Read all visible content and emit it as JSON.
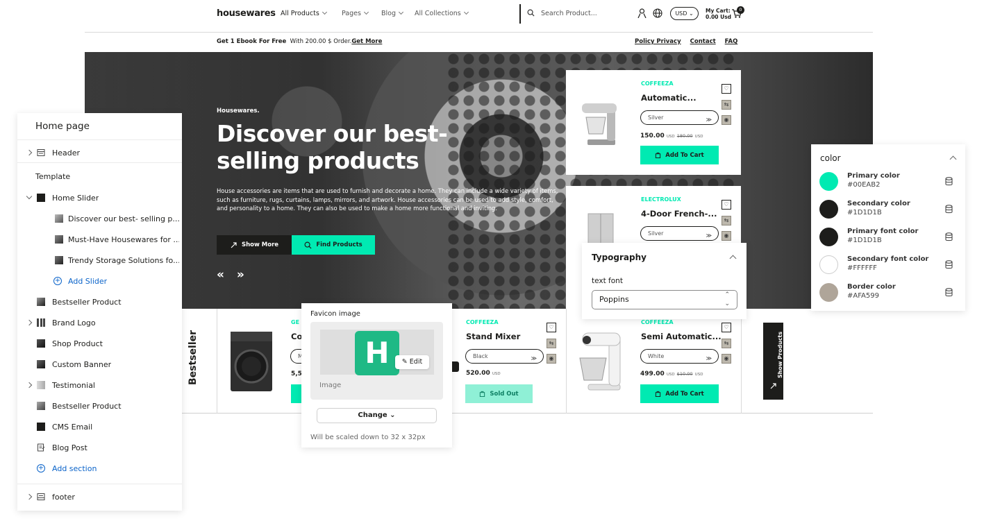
{
  "nav": {
    "logo": "housewares",
    "menu": [
      "All Products",
      "Pages",
      "Blog",
      "All Collections"
    ],
    "search_placeholder": "Search Product...",
    "currency": "USD",
    "cart_label": "My Cart:",
    "cart_total": "0.00 Usd",
    "cart_count": "0"
  },
  "promo": {
    "bold": "Get 1 Ebook For Free",
    "text": "With 200.00 $ Order.",
    "link": "Get More",
    "links": [
      "Policy Privacy",
      "Contact",
      "FAQ"
    ]
  },
  "hero": {
    "eyebrow": "Housewares.",
    "title": "Discover our best- selling products",
    "description": "House accessories are items that are used to furnish and decorate a home. They can include a wide variety of items, such as furniture, rugs, curtains, lamps, mirrors, and artwork. House accessories can be used to add style, comfort, and personality to a home. They can also be used to make a home more functional and inviting.",
    "btn_more": "Show More",
    "btn_find": "Find Products",
    "arrows": "« »"
  },
  "products": [
    {
      "brand": "COFFEEZA",
      "name": "Automatic...",
      "variant": "Silver",
      "price": "150.00",
      "currency": "USD",
      "old_price": "180.00",
      "old_currency": "USD",
      "cta": "Add To Cart"
    },
    {
      "brand": "ELECTROLUX",
      "name": "4-Door French-...",
      "variant": "Silver"
    },
    {
      "brand": "GE",
      "name": "Co",
      "variant": "M",
      "price": "5,5"
    },
    {
      "brand": "COFFEEZA",
      "name": "Stand Mixer",
      "variant": "Black",
      "price": "520.00",
      "currency": "USD",
      "cta": "Sold Out"
    },
    {
      "brand": "COFFEEZA",
      "name": "Semi Automatic...",
      "variant": "White",
      "price": "499.00",
      "currency": "USD",
      "old_price": "$10.00",
      "old_currency": "USD",
      "cta": "Add To Cart"
    }
  ],
  "strip": {
    "bestseller_label": "Bestseller",
    "show_products": "Show Products"
  },
  "sidebar": {
    "title": "Home page",
    "header": "Header",
    "template": "Template",
    "home_slider": "Home Slider",
    "slides": [
      "Discover our best- selling p...",
      "Must-Have Housewares for ...",
      "Trendy Storage Solutions fo..."
    ],
    "add_slider": "Add Slider",
    "sections": [
      "Bestseller Product",
      "Brand Logo",
      "Shop Product",
      "Custom Banner",
      "Testimonial",
      "Bestseller Product",
      "CMS Email",
      "Blog Post"
    ],
    "add_section": "Add section",
    "footer": "footer"
  },
  "favicon": {
    "title": "Favicon image",
    "letter": "H",
    "edit": "Edit",
    "image_label": "Image",
    "change": "Change",
    "hint": "Will be scaled down to 32 x 32px"
  },
  "typography": {
    "title": "Typography",
    "label": "text font",
    "value": "Poppins"
  },
  "color": {
    "title": "color",
    "items": [
      {
        "name": "Primary color",
        "hex": "#00EAB2"
      },
      {
        "name": "Secondary color",
        "hex": "#1D1D1B"
      },
      {
        "name": "Primary font color",
        "hex": "#1D1D1B"
      },
      {
        "name": "Secondary font color",
        "hex": "#FFFFFF"
      },
      {
        "name": "Border color",
        "hex": "#AFA599"
      }
    ]
  }
}
